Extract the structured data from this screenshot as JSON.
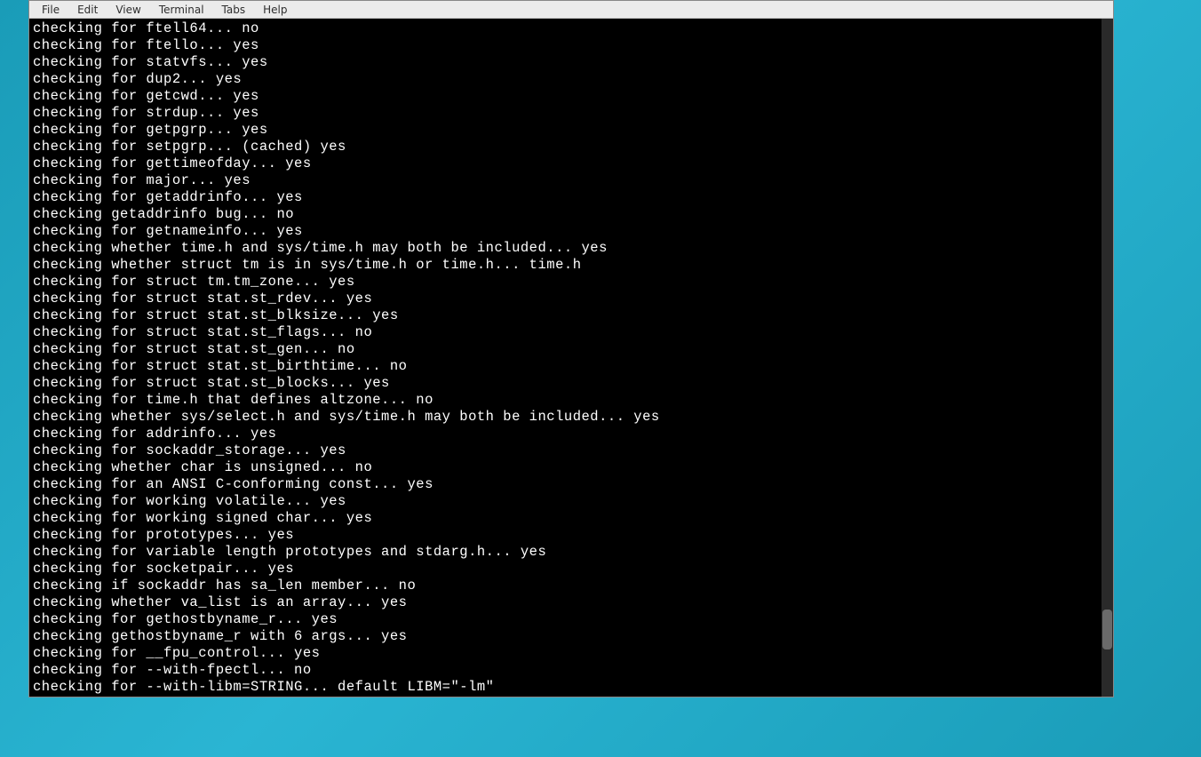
{
  "menubar": {
    "items": [
      {
        "label": "File"
      },
      {
        "label": "Edit"
      },
      {
        "label": "View"
      },
      {
        "label": "Terminal"
      },
      {
        "label": "Tabs"
      },
      {
        "label": "Help"
      }
    ]
  },
  "terminal": {
    "lines": [
      "checking for ftell64... no",
      "checking for ftello... yes",
      "checking for statvfs... yes",
      "checking for dup2... yes",
      "checking for getcwd... yes",
      "checking for strdup... yes",
      "checking for getpgrp... yes",
      "checking for setpgrp... (cached) yes",
      "checking for gettimeofday... yes",
      "checking for major... yes",
      "checking for getaddrinfo... yes",
      "checking getaddrinfo bug... no",
      "checking for getnameinfo... yes",
      "checking whether time.h and sys/time.h may both be included... yes",
      "checking whether struct tm is in sys/time.h or time.h... time.h",
      "checking for struct tm.tm_zone... yes",
      "checking for struct stat.st_rdev... yes",
      "checking for struct stat.st_blksize... yes",
      "checking for struct stat.st_flags... no",
      "checking for struct stat.st_gen... no",
      "checking for struct stat.st_birthtime... no",
      "checking for struct stat.st_blocks... yes",
      "checking for time.h that defines altzone... no",
      "checking whether sys/select.h and sys/time.h may both be included... yes",
      "checking for addrinfo... yes",
      "checking for sockaddr_storage... yes",
      "checking whether char is unsigned... no",
      "checking for an ANSI C-conforming const... yes",
      "checking for working volatile... yes",
      "checking for working signed char... yes",
      "checking for prototypes... yes",
      "checking for variable length prototypes and stdarg.h... yes",
      "checking for socketpair... yes",
      "checking if sockaddr has sa_len member... no",
      "checking whether va_list is an array... yes",
      "checking for gethostbyname_r... yes",
      "checking gethostbyname_r with 6 args... yes",
      "checking for __fpu_control... yes",
      "checking for --with-fpectl... no",
      "checking for --with-libm=STRING... default LIBM=\"-lm\""
    ]
  }
}
